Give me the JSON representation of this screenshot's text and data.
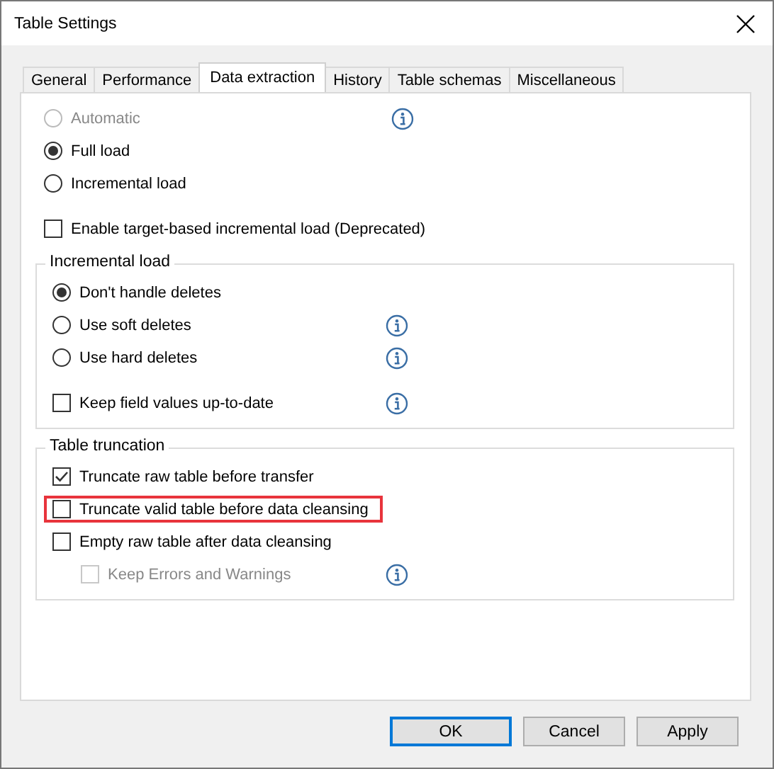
{
  "window": {
    "title": "Table Settings"
  },
  "tabs": [
    {
      "label": "General",
      "selected": false
    },
    {
      "label": "Performance",
      "selected": false
    },
    {
      "label": "Data extraction",
      "selected": true
    },
    {
      "label": "History",
      "selected": false
    },
    {
      "label": "Table schemas",
      "selected": false
    },
    {
      "label": "Miscellaneous",
      "selected": false
    }
  ],
  "options": [
    {
      "kind": "radio",
      "label": "Automatic",
      "selected": false,
      "disabled": true,
      "info": true
    },
    {
      "kind": "radio",
      "label": "Full load",
      "selected": true,
      "disabled": false,
      "info": false
    },
    {
      "kind": "radio",
      "label": "Incremental load",
      "selected": false,
      "disabled": false,
      "info": false
    },
    {
      "kind": "checkbox",
      "label": "Enable target-based incremental load (Deprecated)",
      "checked": false,
      "disabled": false,
      "info": false
    }
  ],
  "groups": [
    {
      "title": "Incremental load",
      "options": [
        {
          "kind": "radio",
          "label": "Don't handle deletes",
          "selected": true,
          "disabled": false,
          "info": false
        },
        {
          "kind": "radio",
          "label": "Use soft deletes",
          "selected": false,
          "disabled": false,
          "info": true
        },
        {
          "kind": "radio",
          "label": "Use hard deletes",
          "selected": false,
          "disabled": false,
          "info": true
        },
        {
          "kind": "checkbox",
          "label": "Keep field values up-to-date",
          "checked": false,
          "disabled": false,
          "info": true
        }
      ]
    },
    {
      "title": "Table truncation",
      "options": [
        {
          "kind": "checkbox",
          "label": "Truncate raw table before transfer",
          "checked": true,
          "disabled": false,
          "info": false
        },
        {
          "kind": "checkbox",
          "label": "Truncate valid table before data cleansing",
          "checked": false,
          "disabled": false,
          "info": false,
          "highlighted": true
        },
        {
          "kind": "checkbox",
          "label": "Empty raw table after data cleansing",
          "checked": false,
          "disabled": false,
          "info": false,
          "children": [
            {
              "kind": "checkbox",
              "label": "Keep Errors and Warnings",
              "checked": false,
              "disabled": true,
              "info": true
            }
          ]
        }
      ]
    }
  ],
  "buttons": [
    {
      "label": "OK",
      "default": true
    },
    {
      "label": "Cancel",
      "default": false
    },
    {
      "label": "Apply",
      "default": false
    }
  ]
}
